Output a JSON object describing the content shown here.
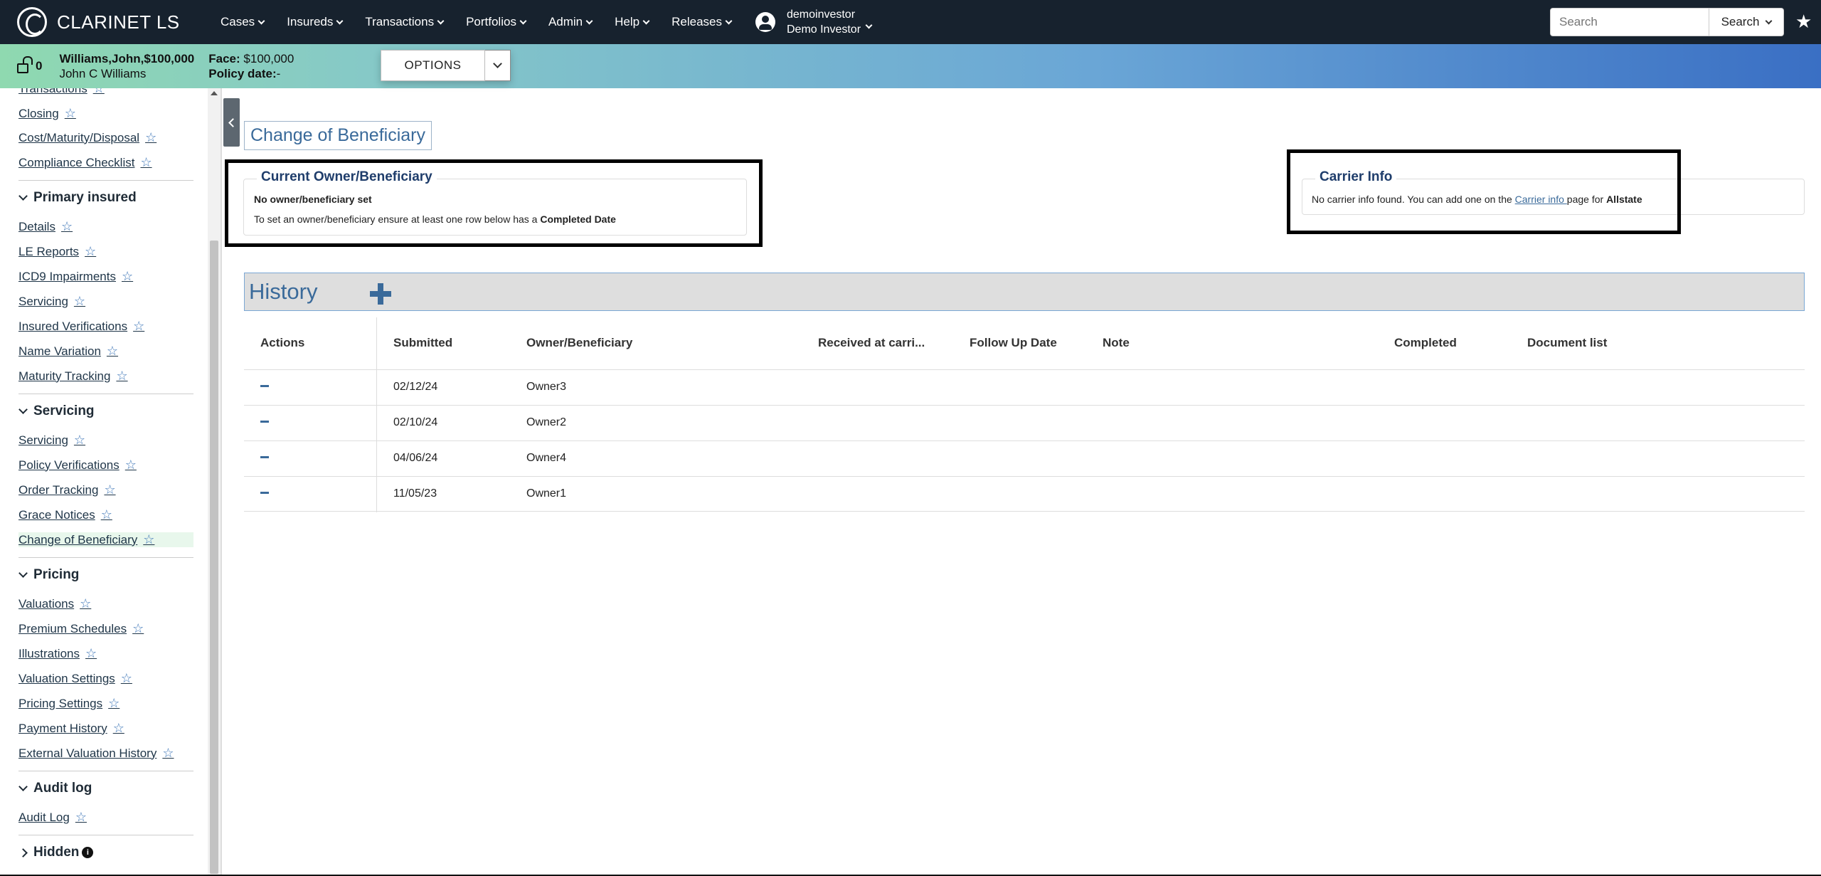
{
  "app": {
    "brand": "CLARINET LS"
  },
  "nav": {
    "items": [
      "Cases",
      "Insureds",
      "Transactions",
      "Portfolios",
      "Admin",
      "Help",
      "Releases"
    ],
    "user": {
      "username": "demoinvestor",
      "display_name": "Demo Investor"
    },
    "search": {
      "placeholder": "Search",
      "button_label": "Search"
    }
  },
  "case": {
    "lock_count": "0",
    "title": "Williams,John,$100,000",
    "insured_name": "John C Williams",
    "face_label": "Face:",
    "face_value": "$100,000",
    "policy_date_label": "Policy date:",
    "policy_date_value": "-",
    "options_label": "OPTIONS"
  },
  "sidebar": {
    "top_links": [
      {
        "label": "Transactions"
      },
      {
        "label": "Closing"
      },
      {
        "label": "Cost/Maturity/Disposal"
      },
      {
        "label": "Compliance Checklist"
      }
    ],
    "sections": [
      {
        "title": "Primary insured",
        "links": [
          "Details",
          "LE Reports",
          "ICD9 Impairments",
          "Servicing",
          "Insured Verifications",
          "Name Variation",
          "Maturity Tracking"
        ]
      },
      {
        "title": "Servicing",
        "links": [
          "Servicing",
          "Policy Verifications",
          "Order Tracking",
          "Grace Notices",
          "Change of Beneficiary"
        ]
      },
      {
        "title": "Pricing",
        "links": [
          "Valuations",
          "Premium Schedules",
          "Illustrations",
          "Valuation Settings",
          "Pricing Settings",
          "Payment History",
          "External Valuation History"
        ]
      },
      {
        "title": "Audit log",
        "links": [
          "Audit Log"
        ]
      }
    ],
    "hidden_label": "Hidden",
    "active_link": "Change of Beneficiary"
  },
  "main": {
    "page_title": "Change of Beneficiary",
    "current_owner": {
      "legend": "Current Owner/Beneficiary",
      "line1": "No owner/beneficiary set",
      "line2_prefix": "To set an owner/beneficiary ensure at least one row below has a ",
      "line2_bold": "Completed Date"
    },
    "carrier_info": {
      "legend": "Carrier Info",
      "text_prefix": "No carrier info found. You can add one on the ",
      "link": "Carrier info ",
      "text_mid": "page for ",
      "carrier": "Allstate"
    },
    "history": {
      "title": "History",
      "columns": [
        "Actions",
        "Submitted",
        "Owner/Beneficiary",
        "Received at carri...",
        "Follow Up Date",
        "Note",
        "Completed",
        "Document list"
      ],
      "rows": [
        {
          "submitted": "02/12/24",
          "owner": "Owner3"
        },
        {
          "submitted": "02/10/24",
          "owner": "Owner2"
        },
        {
          "submitted": "04/06/24",
          "owner": "Owner4"
        },
        {
          "submitted": "11/05/23",
          "owner": "Owner1"
        }
      ]
    }
  },
  "colors": {
    "navbar": "#17222e",
    "link": "#3a6a9a",
    "legend": "#1f3d6b"
  }
}
